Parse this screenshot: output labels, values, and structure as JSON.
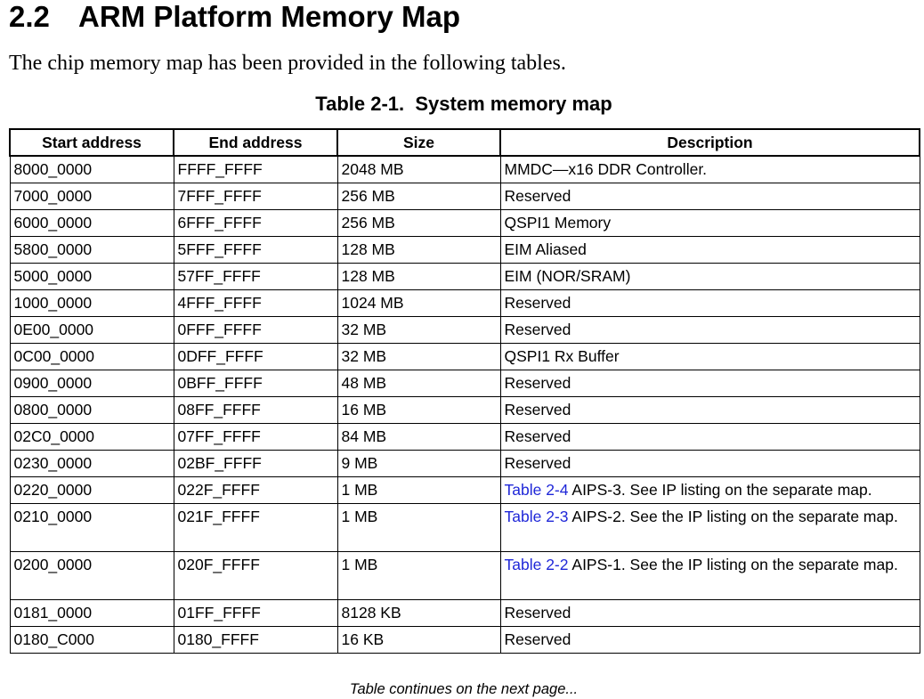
{
  "heading": {
    "number": "2.2",
    "title": "ARM Platform Memory Map"
  },
  "intro": "The chip memory map has been provided in the following tables.",
  "table": {
    "caption": "Table 2-1.  System memory map",
    "columns": [
      "Start address",
      "End address",
      "Size",
      "Description"
    ],
    "rows": [
      {
        "start": "8000_0000",
        "end": "FFFF_FFFF",
        "size": "2048 MB",
        "link": "",
        "desc": "MMDC—x16 DDR Controller."
      },
      {
        "start": "7000_0000",
        "end": "7FFF_FFFF",
        "size": "256 MB",
        "link": "",
        "desc": "Reserved"
      },
      {
        "start": "6000_0000",
        "end": "6FFF_FFFF",
        "size": "256 MB",
        "link": "",
        "desc": "QSPI1 Memory"
      },
      {
        "start": "5800_0000",
        "end": "5FFF_FFFF",
        "size": "128 MB",
        "link": "",
        "desc": "EIM Aliased"
      },
      {
        "start": "5000_0000",
        "end": "57FF_FFFF",
        "size": "128 MB",
        "link": "",
        "desc": "EIM (NOR/SRAM)"
      },
      {
        "start": "1000_0000",
        "end": "4FFF_FFFF",
        "size": "1024 MB",
        "link": "",
        "desc": "Reserved"
      },
      {
        "start": "0E00_0000",
        "end": "0FFF_FFFF",
        "size": "32 MB",
        "link": "",
        "desc": "Reserved"
      },
      {
        "start": "0C00_0000",
        "end": "0DFF_FFFF",
        "size": "32 MB",
        "link": "",
        "desc": "QSPI1 Rx Buffer"
      },
      {
        "start": "0900_0000",
        "end": "0BFF_FFFF",
        "size": "48 MB",
        "link": "",
        "desc": "Reserved"
      },
      {
        "start": "0800_0000",
        "end": "08FF_FFFF",
        "size": "16 MB",
        "link": "",
        "desc": "Reserved"
      },
      {
        "start": "02C0_0000",
        "end": "07FF_FFFF",
        "size": "84 MB",
        "link": "",
        "desc": "Reserved"
      },
      {
        "start": "0230_0000",
        "end": "02BF_FFFF",
        "size": "9 MB",
        "link": "",
        "desc": "Reserved"
      },
      {
        "start": "0220_0000",
        "end": "022F_FFFF",
        "size": "1 MB",
        "link": "Table 2-4",
        "desc": " AIPS-3. See IP listing on the separate map."
      },
      {
        "start": "0210_0000",
        "end": "021F_FFFF",
        "size": "1 MB",
        "link": "Table 2-3",
        "desc": " AIPS-2. See the IP listing on the separate map.",
        "tall": true
      },
      {
        "start": "0200_0000",
        "end": "020F_FFFF",
        "size": "1 MB",
        "link": "Table 2-2",
        "desc": " AIPS-1. See the IP listing on the separate map.",
        "tall": true
      },
      {
        "start": "0181_0000",
        "end": "01FF_FFFF",
        "size": "8128 KB",
        "link": "",
        "desc": "Reserved"
      },
      {
        "start": "0180_C000",
        "end": "0180_FFFF",
        "size": "16 KB",
        "link": "",
        "desc": "Reserved"
      }
    ]
  },
  "footer": "Table continues on the next page...",
  "colors": {
    "link": "#1f27d8",
    "text": "#000000",
    "background": "#ffffff"
  }
}
